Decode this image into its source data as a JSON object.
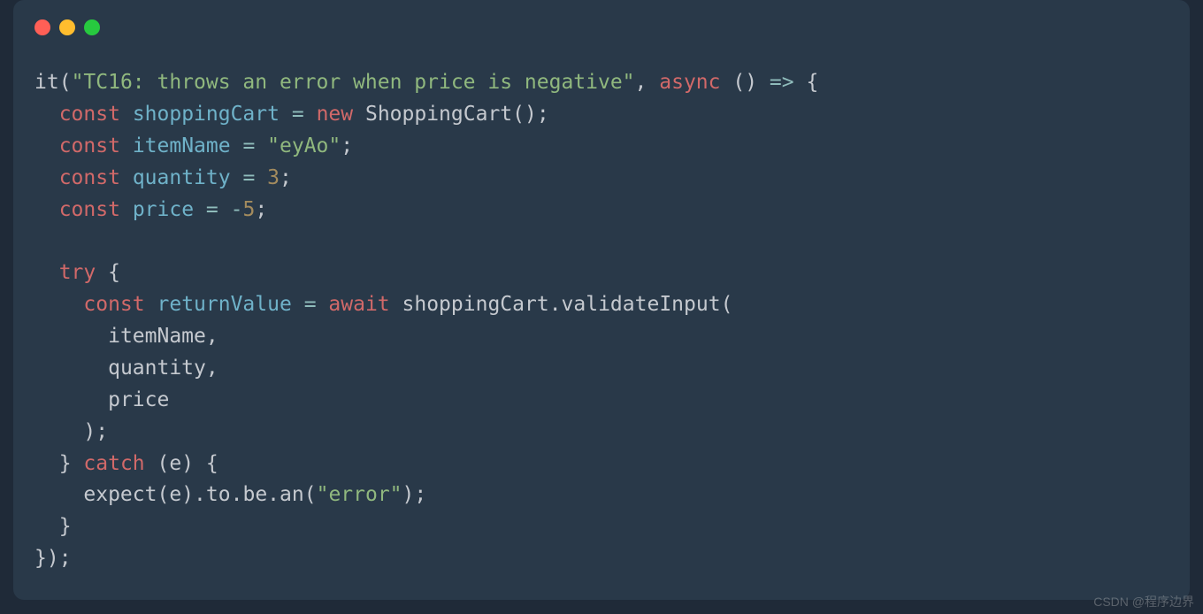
{
  "code": {
    "line1": {
      "fn": "it",
      "p1": "(",
      "str": "\"TC16: throws an error when price is negative\"",
      "p2": ", ",
      "kw": "async",
      "p3": " () ",
      "arrow": "=>",
      "p4": " {"
    },
    "line2": {
      "in": "  ",
      "kw": "const",
      "sp": " ",
      "var": "shoppingCart",
      "sp2": " ",
      "op": "=",
      "sp3": " ",
      "kw2": "new",
      "sp4": " ",
      "cls": "ShoppingCart",
      "rest": "();"
    },
    "line3": {
      "in": "  ",
      "kw": "const",
      "sp": " ",
      "var": "itemName",
      "sp2": " ",
      "op": "=",
      "sp3": " ",
      "str": "\"eyAo\"",
      "rest": ";"
    },
    "line4": {
      "in": "  ",
      "kw": "const",
      "sp": " ",
      "var": "quantity",
      "sp2": " ",
      "op": "=",
      "sp3": " ",
      "num": "3",
      "rest": ";"
    },
    "line5": {
      "in": "  ",
      "kw": "const",
      "sp": " ",
      "var": "price",
      "sp2": " ",
      "op": "=",
      "sp3": " ",
      "neg": "-",
      "num": "5",
      "rest": ";"
    },
    "line6": "",
    "line7": {
      "in": "  ",
      "kw": "try",
      "rest": " {"
    },
    "line8": {
      "in": "    ",
      "kw": "const",
      "sp": " ",
      "var": "returnValue",
      "sp2": " ",
      "op": "=",
      "sp3": " ",
      "kw2": "await",
      "sp4": " ",
      "obj": "shoppingCart",
      "dot": ".",
      "meth": "validateInput",
      "rest": "("
    },
    "line9": {
      "in": "      ",
      "var": "itemName",
      "rest": ","
    },
    "line10": {
      "in": "      ",
      "var": "quantity",
      "rest": ","
    },
    "line11": {
      "in": "      ",
      "var": "price"
    },
    "line12": {
      "in": "    ",
      "rest": ");"
    },
    "line13": {
      "in": "  ",
      "b1": "} ",
      "kw": "catch",
      "sp": " (",
      "var": "e",
      "rest": ") {"
    },
    "line14": {
      "in": "    ",
      "fn": "expect",
      "p1": "(",
      "var": "e",
      "p2": ").",
      "m1": "to",
      "d1": ".",
      "m2": "be",
      "d2": ".",
      "m3": "an",
      "p3": "(",
      "str": "\"error\"",
      "rest": ");"
    },
    "line15": {
      "in": "  ",
      "rest": "}"
    },
    "line16": {
      "rest": "});"
    }
  },
  "watermark": "CSDN @程序边界"
}
